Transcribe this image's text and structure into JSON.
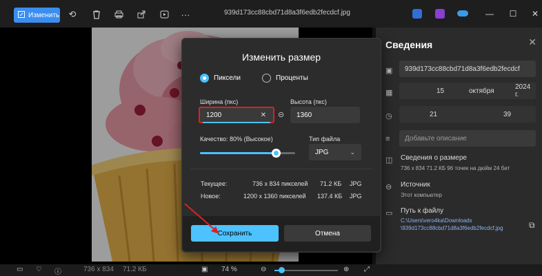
{
  "titlebar": {
    "edit_label": "Изменить",
    "filename": "939d173cc88cbd71d8a3f6edb2fecdcf.jpg"
  },
  "dialog": {
    "title": "Изменить размер",
    "radio_pixels": "Пиксели",
    "radio_percent": "Проценты",
    "width_label": "Ширина (пкс)",
    "width_value": "1200",
    "height_label": "Высота (пкс)",
    "height_value": "1360",
    "quality_label": "Качество: 80% (Высокое)",
    "quality_value": 0.8,
    "filetype_label": "Тип файла",
    "filetype_value": "JPG",
    "current_label": "Текущее:",
    "current_dims": "736 x 834 пикселей",
    "current_size": "71.2 КБ",
    "current_type": "JPG",
    "new_label": "Новое:",
    "new_dims": "1200 x 1360 пикселей",
    "new_size": "137.4 КБ",
    "new_type": "JPG",
    "save_label": "Сохранить",
    "cancel_label": "Отмена"
  },
  "panel": {
    "title": "Сведения",
    "name_value": "939d173cc88cbd71d8a3f6edb2fecdcf",
    "date_day": "15",
    "date_month": "октября",
    "date_year": "2024 г.",
    "time_hour": "21",
    "time_min": "39",
    "desc_placeholder": "Добавьте описание",
    "size_title": "Сведения о размере",
    "size_details": "736 x 834   71.2 КБ   96 точек на дюйм   24 бит",
    "source_title": "Источник",
    "source_value": "Этот компьютер",
    "path_title": "Путь к файлу",
    "path_line1": "C:\\Users\\vero4ka\\Downloads",
    "path_line2": "\\939d173cc88cbd71d8a3f6edb2fecdcf.jpg"
  },
  "bottombar": {
    "dims": "736 x 834",
    "size": "71.2 КБ",
    "zoom": "74 %"
  },
  "colors": {
    "accent": "#4cc2ff",
    "edit_button": "#3b8ef0",
    "highlight_red": "#e02020"
  },
  "icons": [
    "edit-icon",
    "rotate-icon",
    "delete-icon",
    "print-icon",
    "share-icon",
    "slideshow-icon",
    "more-icon",
    "close-icon",
    "link-icon",
    "folder-icon",
    "copy-icon",
    "info-icon",
    "heart-icon",
    "zoom-in-icon",
    "zoom-out-icon",
    "fullscreen-icon"
  ]
}
